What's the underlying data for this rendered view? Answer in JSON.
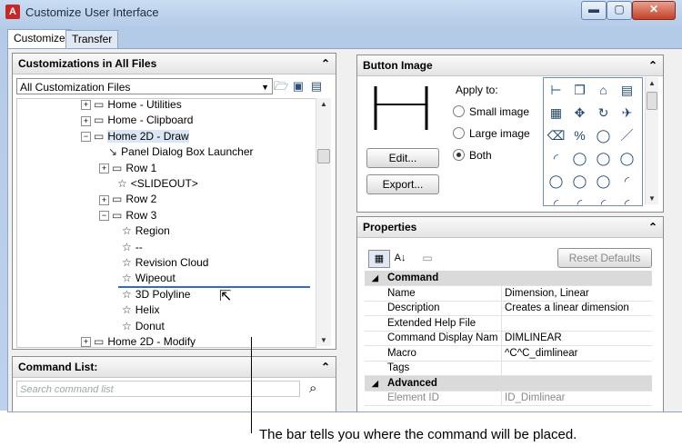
{
  "window": {
    "title": "Customize User Interface"
  },
  "tabs": [
    {
      "label": "Customize"
    },
    {
      "label": "Transfer"
    }
  ],
  "customizations": {
    "header": "Customizations in All Files",
    "dropdown_value": "All Customization Files",
    "tree": [
      {
        "label": "Home - Utilities",
        "expander": "+",
        "icon": "ribbon-panel"
      },
      {
        "label": "Home - Clipboard",
        "expander": "+",
        "icon": "ribbon-panel"
      },
      {
        "label": "Home 2D - Draw",
        "expander": "−",
        "icon": "ribbon-panel"
      },
      {
        "label": "Panel Dialog Box Launcher",
        "expander": "",
        "icon": "launcher"
      },
      {
        "label": "Row 1",
        "expander": "+",
        "icon": "row"
      },
      {
        "label": "<SLIDEOUT>",
        "expander": "",
        "icon": "star"
      },
      {
        "label": "Row 2",
        "expander": "+",
        "icon": "row"
      },
      {
        "label": "Row 3",
        "expander": "−",
        "icon": "row"
      },
      {
        "label": "Region",
        "expander": "",
        "icon": "star"
      },
      {
        "label": "--",
        "expander": "",
        "icon": "star"
      },
      {
        "label": "Revision Cloud",
        "expander": "",
        "icon": "star"
      },
      {
        "label": "Wipeout",
        "expander": "",
        "icon": "star"
      },
      {
        "label": "3D Polyline",
        "expander": "",
        "icon": "star"
      },
      {
        "label": "Helix",
        "expander": "",
        "icon": "star"
      },
      {
        "label": "Donut",
        "expander": "",
        "icon": "star"
      },
      {
        "label": "Home 2D - Modify",
        "expander": "+",
        "icon": "ribbon-panel"
      }
    ]
  },
  "command_list": {
    "header": "Command List:",
    "search_placeholder": "Search command list"
  },
  "button_image": {
    "header": "Button Image",
    "apply_to_label": "Apply to:",
    "options": [
      {
        "label": "Small image",
        "selected": false
      },
      {
        "label": "Large image",
        "selected": false
      },
      {
        "label": "Both",
        "selected": true
      }
    ],
    "edit_label": "Edit...",
    "export_label": "Export...",
    "icons": [
      "dimension-icon",
      "block-icon",
      "camera-icon",
      "layer-icon",
      "array-icon",
      "move-icon",
      "rotate-icon",
      "plane-icon",
      "erase-icon",
      "percent-icon",
      "circle-icon",
      "line-icon",
      "arc-icon",
      "circle-icon",
      "circle-icon",
      "circle-icon",
      "circle-icon",
      "circle-icon",
      "circle-icon",
      "arc-icon",
      "arc-icon",
      "arc-icon",
      "arc-icon",
      "arc-icon"
    ]
  },
  "properties": {
    "header": "Properties",
    "reset_label": "Reset Defaults",
    "rows": [
      {
        "type": "category",
        "name": "Command",
        "value": ""
      },
      {
        "type": "prop",
        "name": "Name",
        "value": "Dimension, Linear"
      },
      {
        "type": "prop",
        "name": "Description",
        "value": "Creates a linear dimension"
      },
      {
        "type": "prop",
        "name": "Extended Help File",
        "value": ""
      },
      {
        "type": "prop",
        "name": "Command Display Name",
        "value": "DIMLINEAR"
      },
      {
        "type": "prop",
        "name": "Macro",
        "value": "^C^C_dimlinear"
      },
      {
        "type": "prop",
        "name": "Tags",
        "value": ""
      },
      {
        "type": "category",
        "name": "Advanced",
        "value": ""
      },
      {
        "type": "prop",
        "name": "Element ID",
        "value": "ID_Dimlinear"
      }
    ]
  },
  "caption": "The bar tells you where the command will be placed."
}
